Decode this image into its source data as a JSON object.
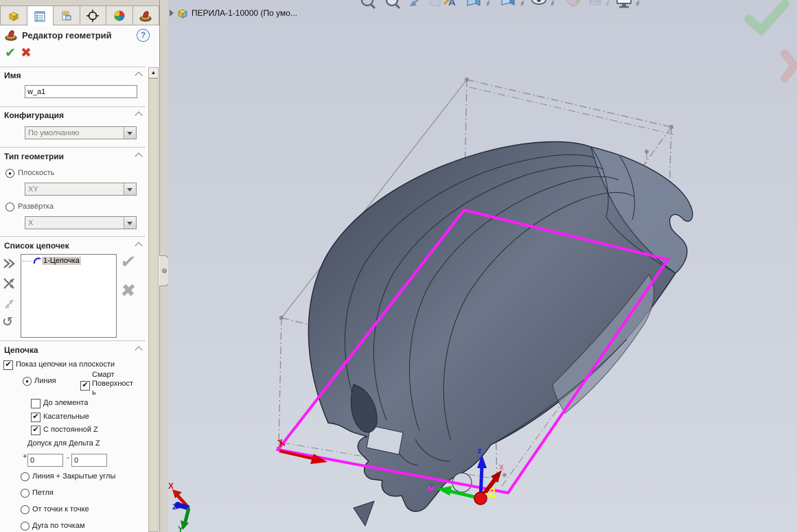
{
  "panel": {
    "title": "Редактор геометрий",
    "help": "?",
    "ok": "✔",
    "cancel": "✖",
    "scroll_up": "▲",
    "sections": {
      "name": {
        "header": "Имя",
        "value": "w_a1"
      },
      "configuration": {
        "header": "Конфигурация",
        "value": "По умолчанию"
      },
      "geometry_type": {
        "header": "Тип геометрии",
        "plane_label": "Плоскость",
        "plane_mark": "●",
        "plane_value": "XY",
        "unfold_label": "Развёртка",
        "unfold_mark": "",
        "unfold_value": "X"
      },
      "chain_list": {
        "header": "Список цепочек",
        "item": "1-Цепочка",
        "apply": "✔",
        "remove": "✖",
        "undo": "↺"
      },
      "chain": {
        "header": "Цепочка",
        "show_label": "Показ цепочки на плоскости",
        "show_mark": "✔",
        "line_label": "Линия",
        "line_mark": "●",
        "smart_label": "Смарт Поверхность",
        "smart_mark": "✔",
        "to_element_label": "До элемента",
        "to_element_mark": "",
        "tangent_label": "Касательные",
        "tangent_mark": "✔",
        "const_z_label": "С постоянной Z",
        "const_z_mark": "✔",
        "tolerance_label": "Допуск для Дельта Z",
        "plus": "+",
        "minus": "-",
        "plus_value": "0",
        "minus_value": "0",
        "line_corners_label": "Линия + Закрытые углы",
        "line_corners_mark": "",
        "loop_label": "Петля",
        "loop_mark": "",
        "p2p_label": "От точки к точке",
        "p2p_mark": "",
        "arc_label": "Дуга по точкам",
        "arc_mark": ""
      }
    }
  },
  "viewport": {
    "feature_tree_item": "ПЕРИЛА-1-10000  (По умо...",
    "origin_coordinate": "-2",
    "origin_axes": {
      "x": "X",
      "y": "Y",
      "z": "z"
    },
    "triad_axes": {
      "x": "X",
      "y": "Y",
      "z": "Z"
    }
  },
  "colors": {
    "selection_magenta": "#fb1cfb",
    "axis_x_red": "#d40000",
    "axis_y_green": "#00c316",
    "axis_z_blue": "#1616e0",
    "origin_label_yellow": "#ffff00",
    "model_gray": "#5e6678",
    "viewport_background": "#c9ced9"
  }
}
